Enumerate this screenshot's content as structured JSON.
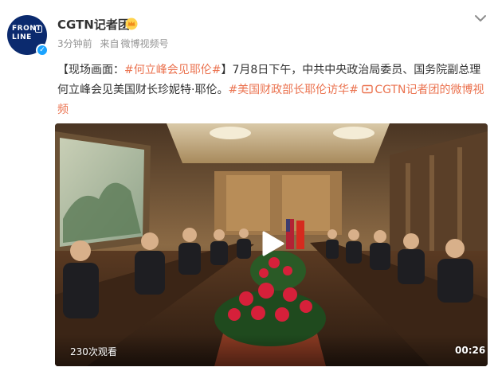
{
  "post": {
    "author": "CGTN记者团",
    "avatar_lines": [
      "FRONT",
      "LINE"
    ],
    "time": "3分钟前",
    "source_prefix": "来自",
    "source": "微博视频号",
    "text": {
      "bracket_open": "【现场画面：",
      "topic1": "#何立峰会见耶伦#",
      "bracket_close": "】",
      "body": "7月8日下午，中共中央政治局委员、国务院副总理何立峰会见美国财长珍妮特·耶伦。",
      "topic2": "#美国财政部长耶伦访华#",
      "video_link": "CGTN记者团的微博视频"
    }
  },
  "video": {
    "views": "230次观看",
    "duration": "00:26"
  },
  "colors": {
    "accent": "#eb7350",
    "verified": "#1aa3ff",
    "avatar_bg": "#0b2a6e"
  },
  "icons": {
    "verified": "check-badge-icon",
    "vip": "vip-crown-icon",
    "menu": "chevron-down-icon",
    "play": "play-icon",
    "video_link": "video-link-icon"
  }
}
